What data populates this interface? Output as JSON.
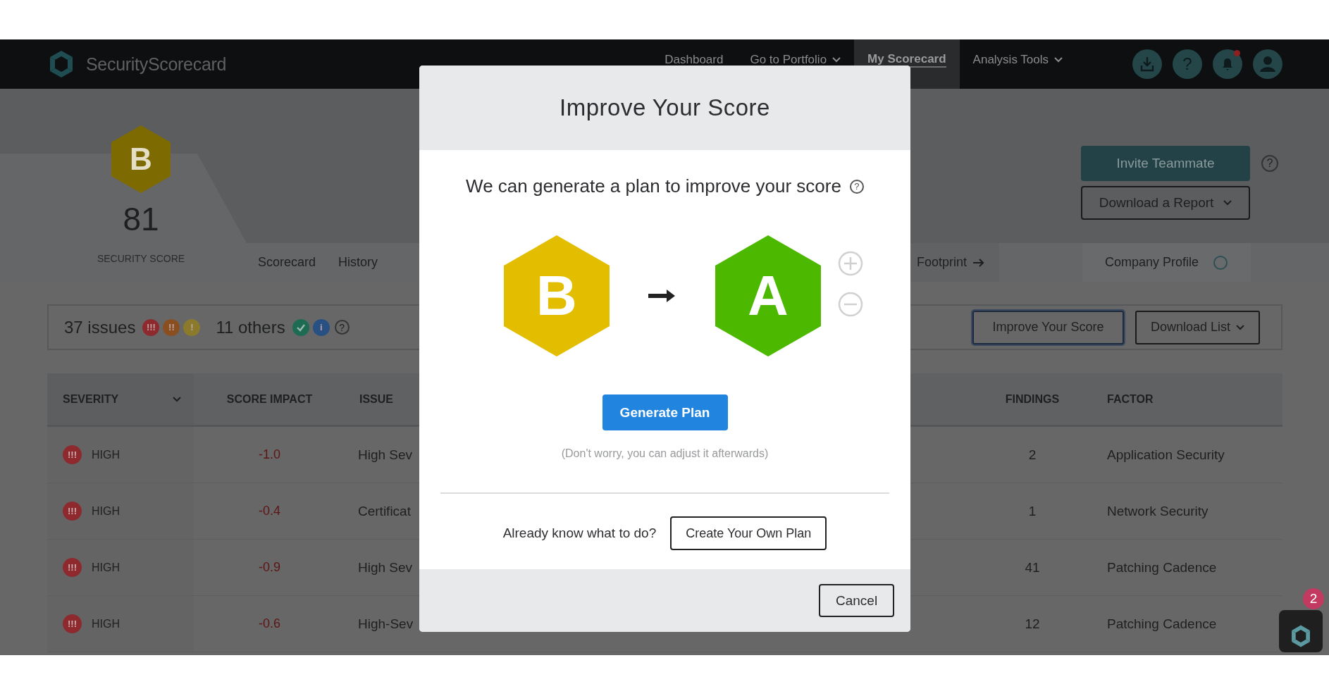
{
  "nav": {
    "brand": "SecurityScorecard",
    "items": [
      {
        "label": "Dashboard",
        "selected": false,
        "dropdown": false
      },
      {
        "label": "Go to Portfolio",
        "selected": false,
        "dropdown": true
      },
      {
        "label": "My Scorecard",
        "selected": true,
        "dropdown": false
      },
      {
        "label": "Analysis Tools",
        "selected": false,
        "dropdown": true
      }
    ],
    "icons": [
      {
        "kind": "download"
      },
      {
        "kind": "help",
        "symbol": "?"
      },
      {
        "kind": "bell",
        "alert": true
      },
      {
        "kind": "user"
      }
    ]
  },
  "score": {
    "grade": "B",
    "value": "81",
    "label": "SECURITY SCORE"
  },
  "header_buttons": [
    {
      "label": "Invite Teammate",
      "kind": "primary"
    },
    {
      "label": "Download a Report",
      "kind": "dropdown"
    }
  ],
  "header_help": "?",
  "tabs": [
    {
      "label": "Scorecard",
      "kind": "plain"
    },
    {
      "label": "History",
      "kind": "plain"
    },
    {
      "label": "Footprint",
      "kind": "link"
    },
    {
      "label": "Company Profile",
      "kind": "profile"
    }
  ],
  "summary": {
    "issues": "37 issues",
    "issue_badges": [
      {
        "kind": "text",
        "symbol": "!!!",
        "color": "#8e2a2e"
      },
      {
        "kind": "text",
        "symbol": "!!",
        "color": "#8a4f20"
      },
      {
        "kind": "text",
        "symbol": "!",
        "color": "#8c7a2c"
      }
    ],
    "others": "11 others",
    "other_badges": [
      {
        "kind": "check",
        "color": "#1c6b52"
      },
      {
        "kind": "text",
        "symbol": "i",
        "color": "#285083"
      }
    ],
    "help": "?"
  },
  "actions": [
    {
      "label": "Improve Your Score",
      "focused": true,
      "dropdown": false
    },
    {
      "label": "Download List",
      "focused": false,
      "dropdown": true
    }
  ],
  "table": {
    "columns": [
      {
        "label": "SEVERITY",
        "sortable": true
      },
      {
        "label": "SCORE IMPACT",
        "sortable": false
      },
      {
        "label": "ISSUE",
        "sortable": false
      },
      {
        "label": "FINDINGS",
        "sortable": false
      },
      {
        "label": "FACTOR",
        "sortable": false
      }
    ],
    "rows": [
      {
        "color": "#8e2a2e",
        "symbol": "!!!",
        "severity": "HIGH",
        "impact": "-1.0",
        "issue": "High Sev",
        "findings": "2",
        "factor": "Application Security"
      },
      {
        "color": "#8e2a2e",
        "symbol": "!!!",
        "severity": "HIGH",
        "impact": "-0.4",
        "issue": "Certificat",
        "findings": "1",
        "factor": "Network Security"
      },
      {
        "color": "#8e2a2e",
        "symbol": "!!!",
        "severity": "HIGH",
        "impact": "-0.9",
        "issue": "High Sev",
        "findings": "41",
        "factor": "Patching Cadence"
      },
      {
        "color": "#8e2a2e",
        "symbol": "!!!",
        "severity": "HIGH",
        "impact": "-0.6",
        "issue": "High-Sev",
        "findings": "12",
        "factor": "Patching Cadence"
      }
    ]
  },
  "modal": {
    "title": "Improve Your Score",
    "prompt": "We can generate a plan to improve your score",
    "help": "?",
    "grades": [
      {
        "letter": "B",
        "color": "#e2bd00"
      },
      {
        "letter": "A",
        "color": "#4cb800"
      }
    ],
    "primary_button": "Generate Plan",
    "note": "(Don't worry, you can adjust it afterwards)",
    "alt_prompt": "Already know what to do?",
    "alt_button": "Create Your Own Plan",
    "cancel": "Cancel"
  },
  "chat": {
    "badge": "2"
  }
}
